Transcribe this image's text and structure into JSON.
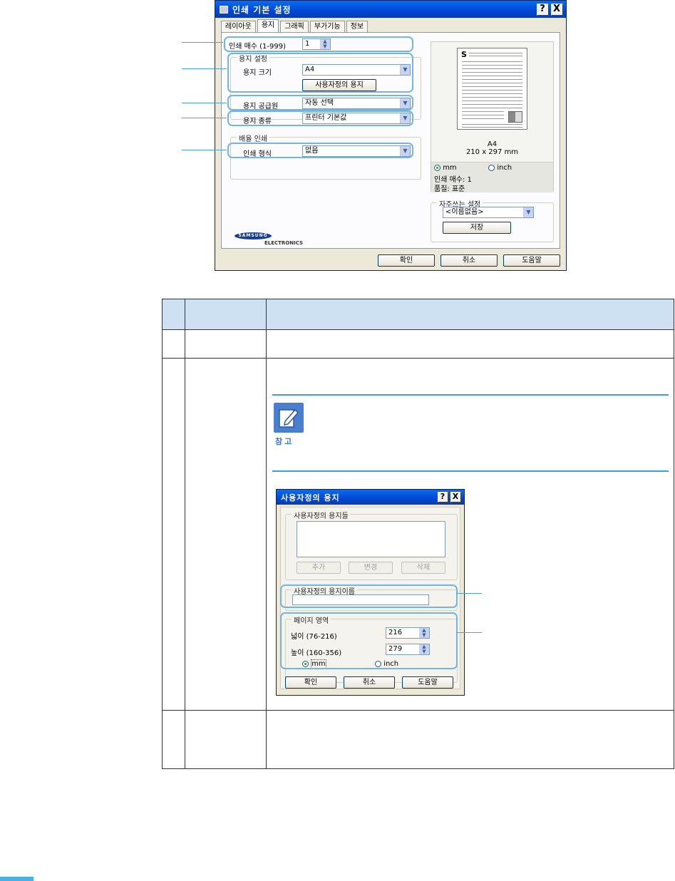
{
  "main_dialog": {
    "title": "인쇄 기본 설정",
    "help_btn": "?",
    "close_btn": "X",
    "tabs": [
      "레이아웃",
      "용지",
      "그래픽",
      "부가기능",
      "정보"
    ],
    "copies_label": "인쇄 매수 (1-999)",
    "copies_value": "1",
    "paper_group_title": "용지 설정",
    "size_label": "용지 크기",
    "size_value": "A4",
    "custom_paper_btn": "사용자정의 용지",
    "source_label": "용지 공급원",
    "source_value": "자동 선택",
    "type_label": "용지 종류",
    "type_value": "프린터 기본값",
    "scale_group_title": "배율 인쇄",
    "scale_label": "인쇄 형식",
    "scale_value": "없음",
    "preview": {
      "letter": "S",
      "paper_name": "A4",
      "paper_dims": "210 x 297 mm",
      "unit_mm": "mm",
      "unit_inch": "inch",
      "copies_text": "인쇄 매수: 1",
      "quality_text": "품질: 표준"
    },
    "favorites_group_title": "자주쓰는 설정",
    "favorites_value": "<이름없음>",
    "save_btn": "저장",
    "logo_top": "SAMSUNG",
    "logo_bottom": "ELECTRONICS",
    "ok_btn": "확인",
    "cancel_btn": "취소",
    "help_btn_label": "도움말"
  },
  "note": {
    "label": "참고"
  },
  "custom_dialog": {
    "title": "사용자정의 용지",
    "help_btn": "?",
    "close_btn": "X",
    "names_group_title": "사용자정의 용지들",
    "add_btn": "추가",
    "change_btn": "변경",
    "delete_btn": "삭제",
    "name_group_title": "사용자정의 용지이름",
    "page_group_title": "페이지 영역",
    "width_label": "넓이 (76-216)",
    "width_value": "216",
    "height_label": "높이 (160-356)",
    "height_value": "279",
    "unit_mm": "mm",
    "unit_inch": "inch",
    "ok_btn": "확인",
    "cancel_btn": "취소",
    "help_btn_label": "도움말"
  },
  "colors": {
    "highlight": "#72b4e8",
    "table_header": "#cde1f2",
    "titlebar": "#0046d5"
  }
}
